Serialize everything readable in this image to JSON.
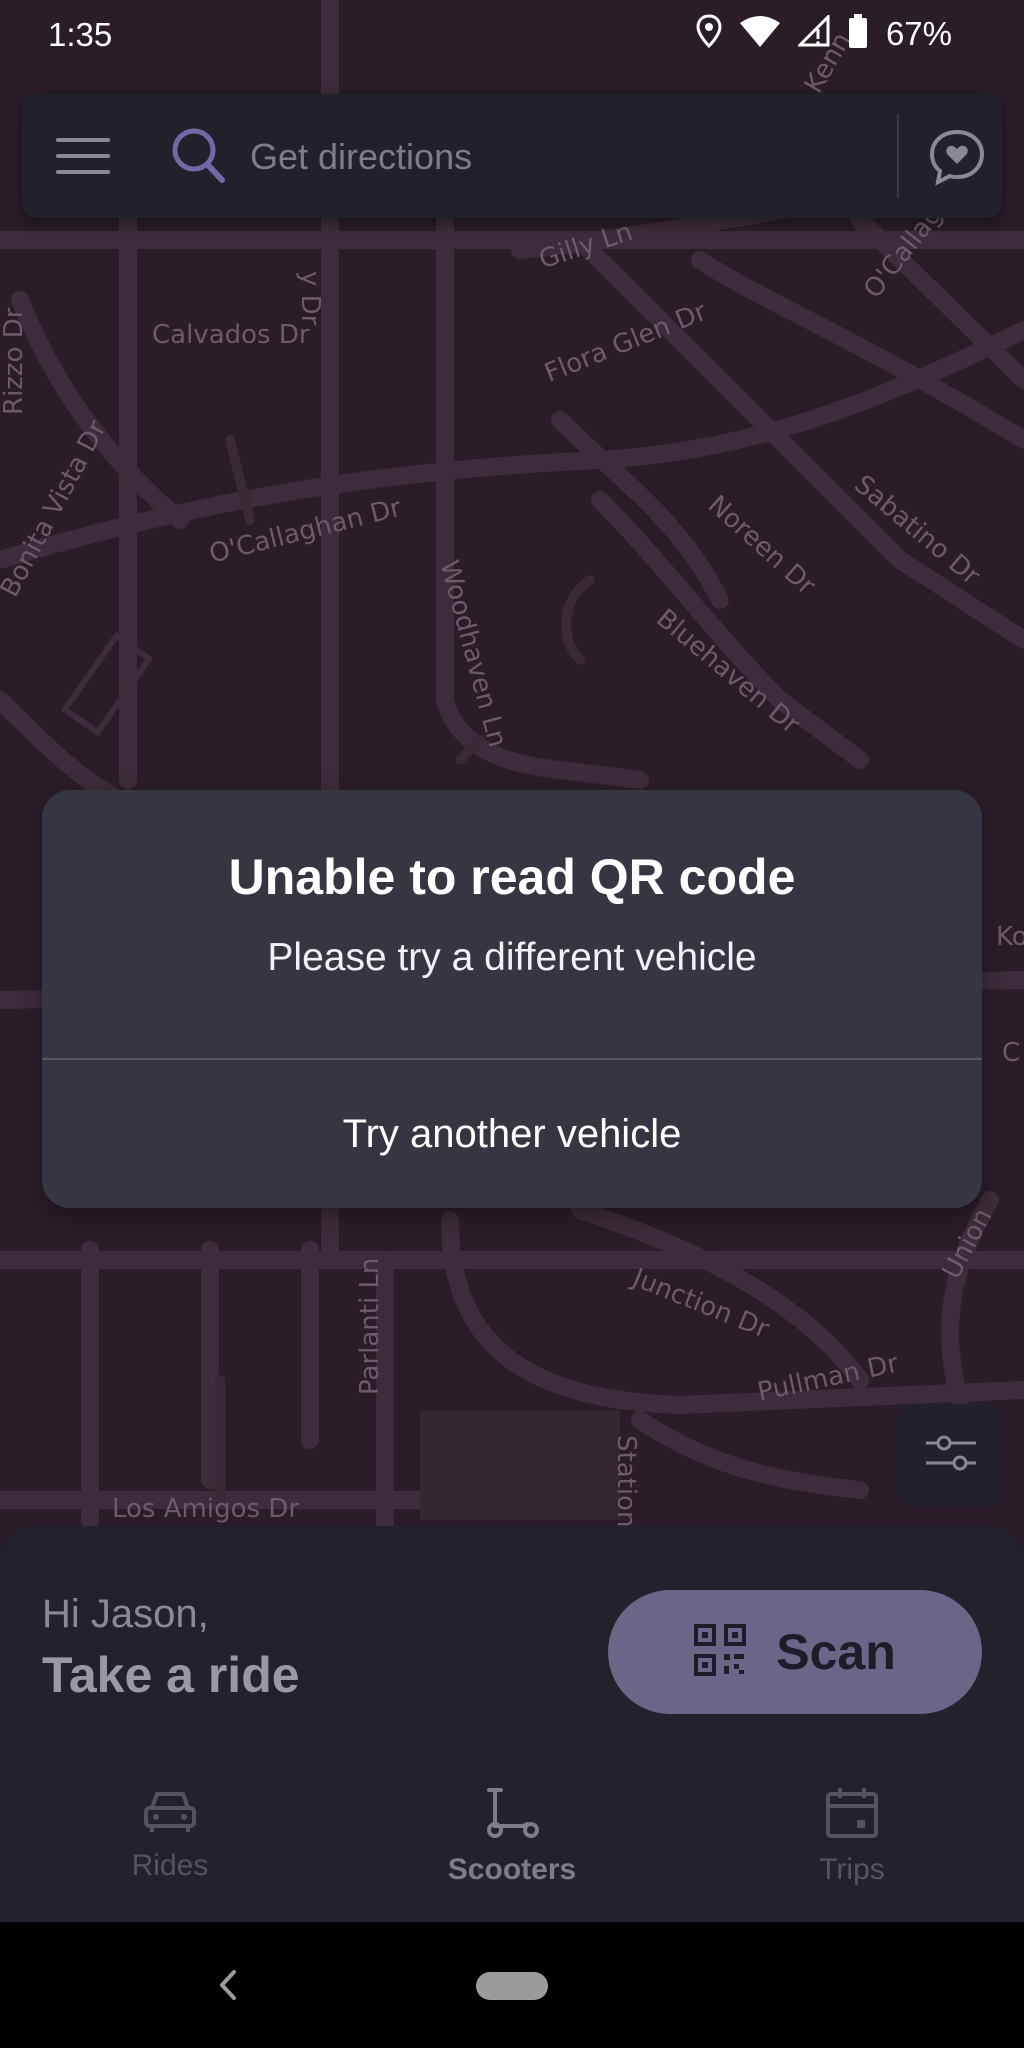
{
  "status_bar": {
    "time": "1:35",
    "battery_text": "67%",
    "icons": [
      "location-icon",
      "wifi-icon",
      "signal-icon",
      "battery-icon"
    ]
  },
  "search": {
    "placeholder": "Get directions",
    "menu_icon": "hamburger-menu-icon",
    "search_icon": "search-icon",
    "chat_icon": "chat-bubble-heart-icon"
  },
  "map": {
    "streets": [
      "Gilly Ln",
      "Calvados Dr",
      "Flora Glen Dr",
      "Rizzo Dr",
      "Bonita Vista Dr",
      "O'Callaghan Dr",
      "Woodhaven Ln",
      "Noreen Dr",
      "Sabatino Dr",
      "Bluehaven Dr",
      "O'Callaghan",
      "Junction Dr",
      "Pullman Dr",
      "Parlanti Ln",
      "Station",
      "Los Amigos Dr",
      "Union",
      "Kenn",
      "y Dr",
      "Ko",
      "C"
    ]
  },
  "dialog": {
    "title": "Unable to read QR code",
    "message": "Please try a different vehicle",
    "action": "Try another vehicle"
  },
  "bottom_sheet": {
    "greeting": "Hi Jason,",
    "headline": "Take a ride",
    "scan_label": "Scan"
  },
  "nav": {
    "items": [
      {
        "label": "Rides",
        "icon": "car-icon"
      },
      {
        "label": "Scooters",
        "icon": "scooter-icon",
        "active": true
      },
      {
        "label": "Trips",
        "icon": "calendar-icon"
      }
    ]
  },
  "colors": {
    "map_bg": "#2a1d27",
    "panel": "#22212b",
    "dialog": "#363542",
    "scan_button": "#6c6588"
  }
}
